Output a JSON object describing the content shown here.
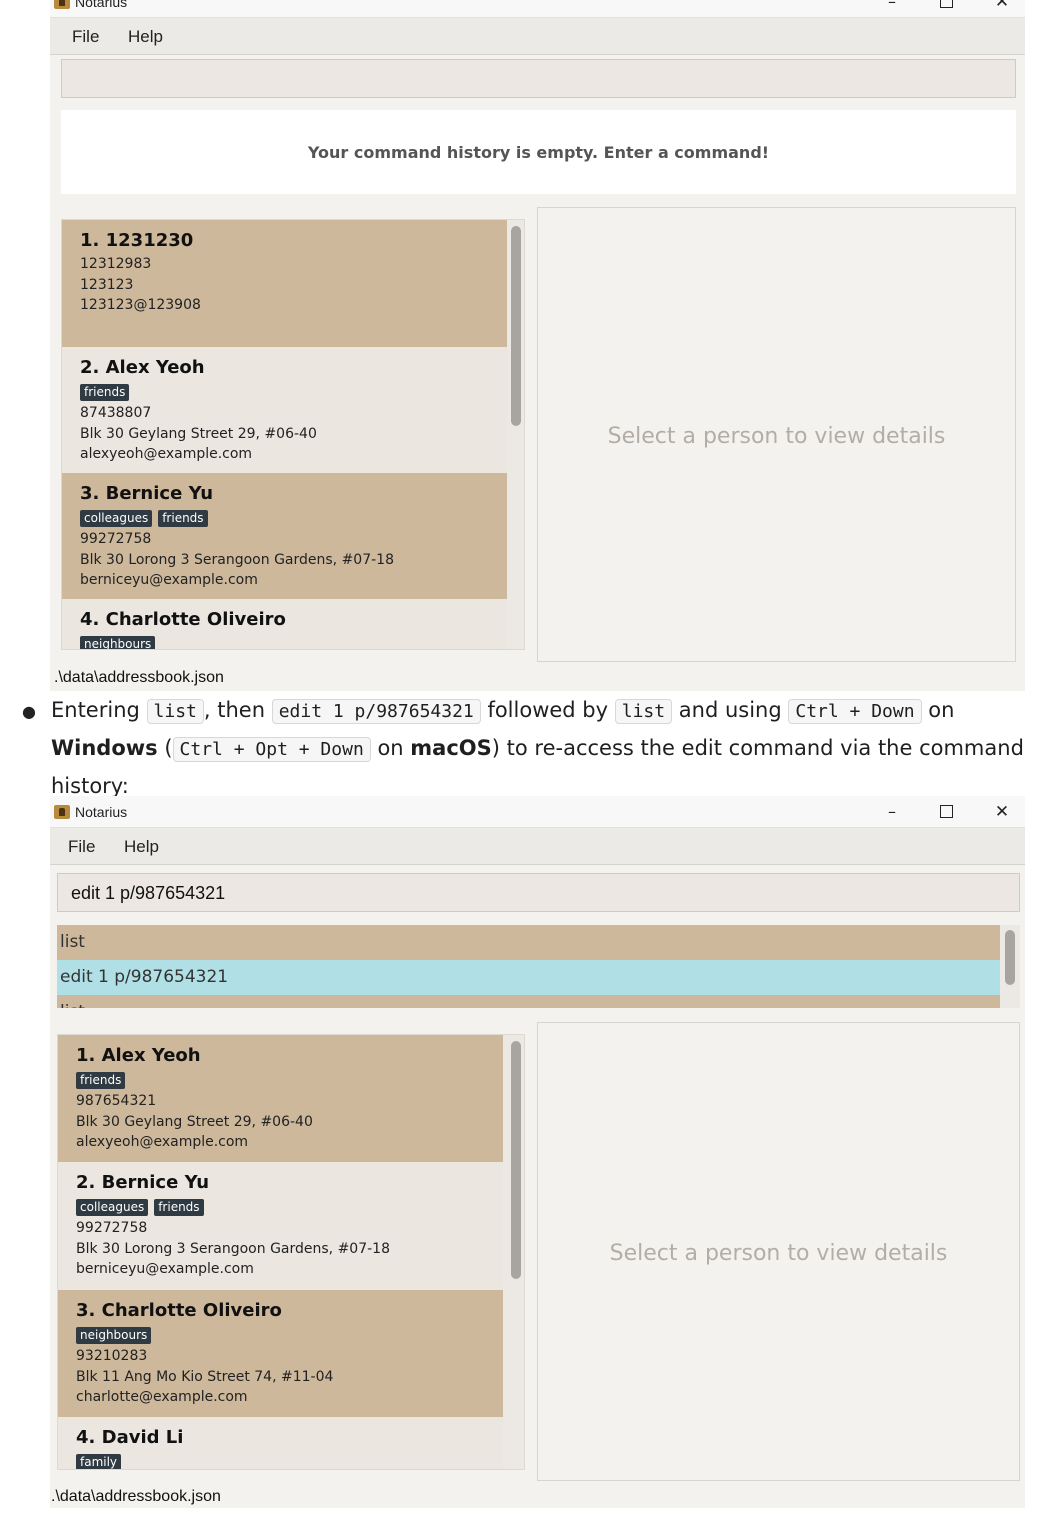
{
  "window1": {
    "title": "Notarius",
    "menu": {
      "file": "File",
      "help": "Help"
    },
    "command_input": {
      "value": ""
    },
    "history_message": "Your command history is empty. Enter a command!",
    "persons": [
      {
        "name": "1. 1231230",
        "tags": [],
        "phone": "12312983",
        "address": "123123",
        "email": "123123@123908"
      },
      {
        "name": "2. Alex Yeoh",
        "tags": [
          "friends"
        ],
        "phone": "87438807",
        "address": "Blk 30 Geylang Street 29, #06-40",
        "email": "alexyeoh@example.com"
      },
      {
        "name": "3. Bernice Yu",
        "tags": [
          "colleagues",
          "friends"
        ],
        "phone": "99272758",
        "address": "Blk 30 Lorong 3 Serangoon Gardens, #07-18",
        "email": "berniceyu@example.com"
      },
      {
        "name": "4. Charlotte Oliveiro",
        "tags": [
          "neighbours"
        ],
        "phone": "",
        "address": "",
        "email": ""
      }
    ],
    "detail_placeholder": "Select a person to view details",
    "status_path": ".\\data\\addressbook.json"
  },
  "instruction": {
    "t1": "Entering ",
    "c1": "list",
    "t2": ", then ",
    "c2": "edit 1 p/987654321",
    "t3": " followed by ",
    "c3": "list",
    "t4": " and using ",
    "c4": "Ctrl + Down",
    "t5": " on ",
    "b1": "Windows",
    "t6": " (",
    "c5": "Ctrl + Opt + Down",
    "t7": " on ",
    "b2": "macOS",
    "t8": ") to re-access the edit command via the command history:"
  },
  "window2": {
    "title": "Notarius",
    "menu": {
      "file": "File",
      "help": "Help"
    },
    "command_input": {
      "value": "edit 1 p/987654321"
    },
    "history": [
      {
        "text": "list",
        "selected": false
      },
      {
        "text": "edit 1 p/987654321",
        "selected": true
      },
      {
        "text": "list",
        "selected": false
      }
    ],
    "persons": [
      {
        "name": "1. Alex Yeoh",
        "tags": [
          "friends"
        ],
        "phone": "987654321",
        "address": "Blk 30 Geylang Street 29, #06-40",
        "email": "alexyeoh@example.com"
      },
      {
        "name": "2. Bernice Yu",
        "tags": [
          "colleagues",
          "friends"
        ],
        "phone": "99272758",
        "address": "Blk 30 Lorong 3 Serangoon Gardens, #07-18",
        "email": "berniceyu@example.com"
      },
      {
        "name": "3. Charlotte Oliveiro",
        "tags": [
          "neighbours"
        ],
        "phone": "93210283",
        "address": "Blk 11 Ang Mo Kio Street 74, #11-04",
        "email": "charlotte@example.com"
      },
      {
        "name": "4. David Li",
        "tags": [
          "family"
        ],
        "phone": "",
        "address": "",
        "email": ""
      }
    ],
    "detail_placeholder": "Select a person to view details",
    "status_path": ".\\data\\addressbook.json"
  },
  "colors": {
    "card_odd": "#cdb89b",
    "card_even": "#ece6e1",
    "tag_bg": "#2f3a42",
    "history_selected": "#b0dfe5"
  }
}
